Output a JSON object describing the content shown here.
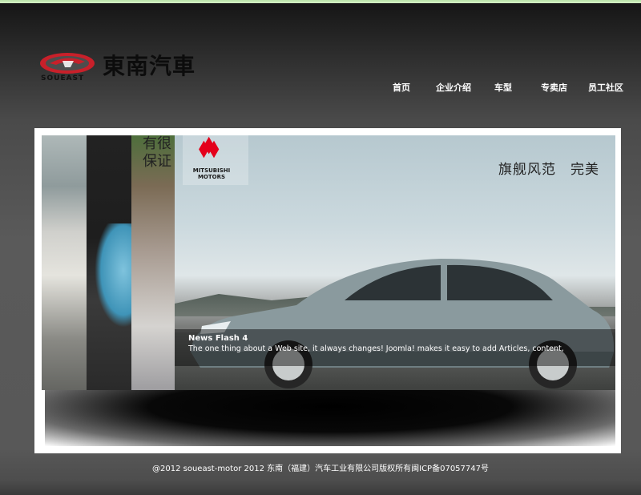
{
  "brand": {
    "logo_title": "東南汽車",
    "logo_sub": "SOUEAST"
  },
  "nav": {
    "items": [
      {
        "label": "首页"
      },
      {
        "label": "企业介绍"
      },
      {
        "label": "车型"
      },
      {
        "label": "专卖店"
      },
      {
        "label": "员工社区"
      }
    ]
  },
  "banner": {
    "overlay_text_line1": "有很",
    "overlay_text_line2": "保证",
    "brand_logo_text": "MITSUBISHI MOTORS",
    "slogan": "旗舰风范　完美",
    "caption_title": "News Flash 4",
    "caption_text": "The one thing about a Web site, it always changes! Joomla! makes it easy to add Articles, content,"
  },
  "footer": {
    "text": "@2012 soueast-motor 2012 东南（福建）汽车工业有限公司版权所有闽ICP备07057747号"
  },
  "colors": {
    "logo_red": "#c8202a",
    "mitsubishi_red": "#e4001b",
    "top_line": "#c4e9b0"
  }
}
